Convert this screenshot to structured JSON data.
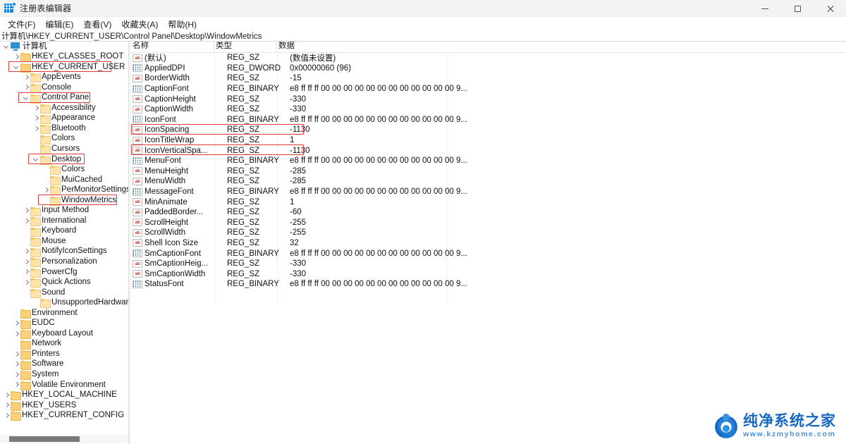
{
  "window": {
    "title": "注册表编辑器",
    "icon": "registry-editor-icon",
    "minimize_label": "最小化",
    "maximize_label": "最大化",
    "close_label": "关闭"
  },
  "menubar": {
    "items": [
      {
        "label": "文件(F)",
        "name": "menu-file"
      },
      {
        "label": "编辑(E)",
        "name": "menu-edit"
      },
      {
        "label": "查看(V)",
        "name": "menu-view"
      },
      {
        "label": "收藏夹(A)",
        "name": "menu-favorites"
      },
      {
        "label": "帮助(H)",
        "name": "menu-help"
      }
    ]
  },
  "address": {
    "path": "计算机\\HKEY_CURRENT_USER\\Control Panel\\Desktop\\WindowMetrics"
  },
  "tree": {
    "nodes": [
      {
        "label": "计算机",
        "indent": 0,
        "chevron": "open",
        "icon": "computer-icon",
        "highlight": false
      },
      {
        "label": "HKEY_CLASSES_ROOT",
        "indent": 1,
        "chevron": "closed",
        "icon": "folder-icon",
        "highlight": false
      },
      {
        "label": "HKEY_CURRENT_USER",
        "indent": 1,
        "chevron": "open",
        "icon": "folder-icon",
        "highlight": true
      },
      {
        "label": "AppEvents",
        "indent": 2,
        "chevron": "closed",
        "icon": "folder-icon",
        "highlight": false
      },
      {
        "label": "Console",
        "indent": 2,
        "chevron": "closed",
        "icon": "folder-icon",
        "highlight": false
      },
      {
        "label": "Control Panel",
        "indent": 2,
        "chevron": "open",
        "icon": "folder-icon",
        "highlight": true
      },
      {
        "label": "Accessibility",
        "indent": 3,
        "chevron": "closed",
        "icon": "folder-icon",
        "highlight": false
      },
      {
        "label": "Appearance",
        "indent": 3,
        "chevron": "closed",
        "icon": "folder-icon",
        "highlight": false
      },
      {
        "label": "Bluetooth",
        "indent": 3,
        "chevron": "closed",
        "icon": "folder-icon",
        "highlight": false
      },
      {
        "label": "Colors",
        "indent": 3,
        "chevron": "none",
        "icon": "folder-icon",
        "highlight": false
      },
      {
        "label": "Cursors",
        "indent": 3,
        "chevron": "none",
        "icon": "folder-icon",
        "highlight": false
      },
      {
        "label": "Desktop",
        "indent": 3,
        "chevron": "open",
        "icon": "folder-icon",
        "highlight": true
      },
      {
        "label": "Colors",
        "indent": 4,
        "chevron": "none",
        "icon": "folder-icon",
        "highlight": false
      },
      {
        "label": "MuiCached",
        "indent": 4,
        "chevron": "none",
        "icon": "folder-icon",
        "highlight": false
      },
      {
        "label": "PerMonitorSettings",
        "indent": 4,
        "chevron": "closed",
        "icon": "folder-icon",
        "highlight": false
      },
      {
        "label": "WindowMetrics",
        "indent": 4,
        "chevron": "none",
        "icon": "folder-icon",
        "highlight": true
      },
      {
        "label": "Input Method",
        "indent": 2,
        "chevron": "closed",
        "icon": "folder-icon",
        "highlight": false
      },
      {
        "label": "International",
        "indent": 2,
        "chevron": "closed",
        "icon": "folder-icon",
        "highlight": false
      },
      {
        "label": "Keyboard",
        "indent": 2,
        "chevron": "none",
        "icon": "folder-icon",
        "highlight": false
      },
      {
        "label": "Mouse",
        "indent": 2,
        "chevron": "none",
        "icon": "folder-icon",
        "highlight": false
      },
      {
        "label": "NotifyIconSettings",
        "indent": 2,
        "chevron": "closed",
        "icon": "folder-icon",
        "highlight": false
      },
      {
        "label": "Personalization",
        "indent": 2,
        "chevron": "closed",
        "icon": "folder-icon",
        "highlight": false
      },
      {
        "label": "PowerCfg",
        "indent": 2,
        "chevron": "closed",
        "icon": "folder-icon",
        "highlight": false
      },
      {
        "label": "Quick Actions",
        "indent": 2,
        "chevron": "closed",
        "icon": "folder-icon",
        "highlight": false
      },
      {
        "label": "Sound",
        "indent": 2,
        "chevron": "none",
        "icon": "folder-icon",
        "highlight": false
      },
      {
        "label": "UnsupportedHardware",
        "indent": 3,
        "chevron": "none",
        "icon": "folder-icon",
        "highlight": false
      },
      {
        "label": "Environment",
        "indent": 1,
        "chevron": "none",
        "icon": "folder-icon",
        "highlight": false
      },
      {
        "label": "EUDC",
        "indent": 1,
        "chevron": "closed",
        "icon": "folder-icon",
        "highlight": false
      },
      {
        "label": "Keyboard Layout",
        "indent": 1,
        "chevron": "closed",
        "icon": "folder-icon",
        "highlight": false
      },
      {
        "label": "Network",
        "indent": 1,
        "chevron": "none",
        "icon": "folder-icon",
        "highlight": false
      },
      {
        "label": "Printers",
        "indent": 1,
        "chevron": "closed",
        "icon": "folder-icon",
        "highlight": false
      },
      {
        "label": "Software",
        "indent": 1,
        "chevron": "closed",
        "icon": "folder-icon",
        "highlight": false
      },
      {
        "label": "System",
        "indent": 1,
        "chevron": "closed",
        "icon": "folder-icon",
        "highlight": false
      },
      {
        "label": "Volatile Environment",
        "indent": 1,
        "chevron": "closed",
        "icon": "folder-icon",
        "highlight": false
      },
      {
        "label": "HKEY_LOCAL_MACHINE",
        "indent": 0,
        "chevron": "closed",
        "icon": "folder-icon",
        "highlight": false
      },
      {
        "label": "HKEY_USERS",
        "indent": 0,
        "chevron": "closed",
        "icon": "folder-icon",
        "highlight": false
      },
      {
        "label": "HKEY_CURRENT_CONFIG",
        "indent": 0,
        "chevron": "closed",
        "icon": "folder-icon",
        "highlight": false
      }
    ]
  },
  "list": {
    "columns": [
      "名称",
      "类型",
      "数据"
    ],
    "rows": [
      {
        "icon": "string-value-icon",
        "kind": "sz",
        "name": "(默认)",
        "type": "REG_SZ",
        "data": "(数值未设置)",
        "highlight": false
      },
      {
        "icon": "dword-value-icon",
        "kind": "bin",
        "name": "AppliedDPI",
        "type": "REG_DWORD",
        "data": "0x00000060 (96)",
        "highlight": false
      },
      {
        "icon": "string-value-icon",
        "kind": "sz",
        "name": "BorderWidth",
        "type": "REG_SZ",
        "data": "-15",
        "highlight": false
      },
      {
        "icon": "binary-value-icon",
        "kind": "bin",
        "name": "CaptionFont",
        "type": "REG_BINARY",
        "data": "e8 ff ff ff 00 00 00 00 00 00 00 00 00 00 00 00 9...",
        "highlight": false
      },
      {
        "icon": "string-value-icon",
        "kind": "sz",
        "name": "CaptionHeight",
        "type": "REG_SZ",
        "data": "-330",
        "highlight": false
      },
      {
        "icon": "string-value-icon",
        "kind": "sz",
        "name": "CaptionWidth",
        "type": "REG_SZ",
        "data": "-330",
        "highlight": false
      },
      {
        "icon": "binary-value-icon",
        "kind": "bin",
        "name": "IconFont",
        "type": "REG_BINARY",
        "data": "e8 ff ff ff 00 00 00 00 00 00 00 00 00 00 00 00 9...",
        "highlight": false
      },
      {
        "icon": "string-value-icon",
        "kind": "sz",
        "name": "IconSpacing",
        "type": "REG_SZ",
        "data": "-1130",
        "highlight": true
      },
      {
        "icon": "string-value-icon",
        "kind": "sz",
        "name": "IconTitleWrap",
        "type": "REG_SZ",
        "data": "1",
        "highlight": false
      },
      {
        "icon": "string-value-icon",
        "kind": "sz",
        "name": "IconVerticalSpa...",
        "type": "REG_SZ",
        "data": "-1130",
        "highlight": true
      },
      {
        "icon": "binary-value-icon",
        "kind": "bin",
        "name": "MenuFont",
        "type": "REG_BINARY",
        "data": "e8 ff ff ff 00 00 00 00 00 00 00 00 00 00 00 00 9...",
        "highlight": false
      },
      {
        "icon": "string-value-icon",
        "kind": "sz",
        "name": "MenuHeight",
        "type": "REG_SZ",
        "data": "-285",
        "highlight": false
      },
      {
        "icon": "string-value-icon",
        "kind": "sz",
        "name": "MenuWidth",
        "type": "REG_SZ",
        "data": "-285",
        "highlight": false
      },
      {
        "icon": "binary-value-icon",
        "kind": "bin",
        "name": "MessageFont",
        "type": "REG_BINARY",
        "data": "e8 ff ff ff 00 00 00 00 00 00 00 00 00 00 00 00 9...",
        "highlight": false
      },
      {
        "icon": "string-value-icon",
        "kind": "sz",
        "name": "MinAnimate",
        "type": "REG_SZ",
        "data": "1",
        "highlight": false
      },
      {
        "icon": "string-value-icon",
        "kind": "sz",
        "name": "PaddedBorder...",
        "type": "REG_SZ",
        "data": "-60",
        "highlight": false
      },
      {
        "icon": "string-value-icon",
        "kind": "sz",
        "name": "ScrollHeight",
        "type": "REG_SZ",
        "data": "-255",
        "highlight": false
      },
      {
        "icon": "string-value-icon",
        "kind": "sz",
        "name": "ScrollWidth",
        "type": "REG_SZ",
        "data": "-255",
        "highlight": false
      },
      {
        "icon": "string-value-icon",
        "kind": "sz",
        "name": "Shell Icon Size",
        "type": "REG_SZ",
        "data": "32",
        "highlight": false
      },
      {
        "icon": "binary-value-icon",
        "kind": "bin",
        "name": "SmCaptionFont",
        "type": "REG_BINARY",
        "data": "e8 ff ff ff 00 00 00 00 00 00 00 00 00 00 00 00 9...",
        "highlight": false
      },
      {
        "icon": "string-value-icon",
        "kind": "sz",
        "name": "SmCaptionHeig...",
        "type": "REG_SZ",
        "data": "-330",
        "highlight": false
      },
      {
        "icon": "string-value-icon",
        "kind": "sz",
        "name": "SmCaptionWidth",
        "type": "REG_SZ",
        "data": "-330",
        "highlight": false
      },
      {
        "icon": "binary-value-icon",
        "kind": "bin",
        "name": "StatusFont",
        "type": "REG_BINARY",
        "data": "e8 ff ff ff 00 00 00 00 00 00 00 00 00 00 00 00 9...",
        "highlight": false
      }
    ]
  },
  "watermark": {
    "brand": "纯净系统之家",
    "url": "www.kzmyhome.com"
  },
  "colors": {
    "highlight_box": "#e03a3a",
    "folder": "#ffd075",
    "accent": "#1668c4",
    "titlebar_bg": "#f3f3f3"
  }
}
